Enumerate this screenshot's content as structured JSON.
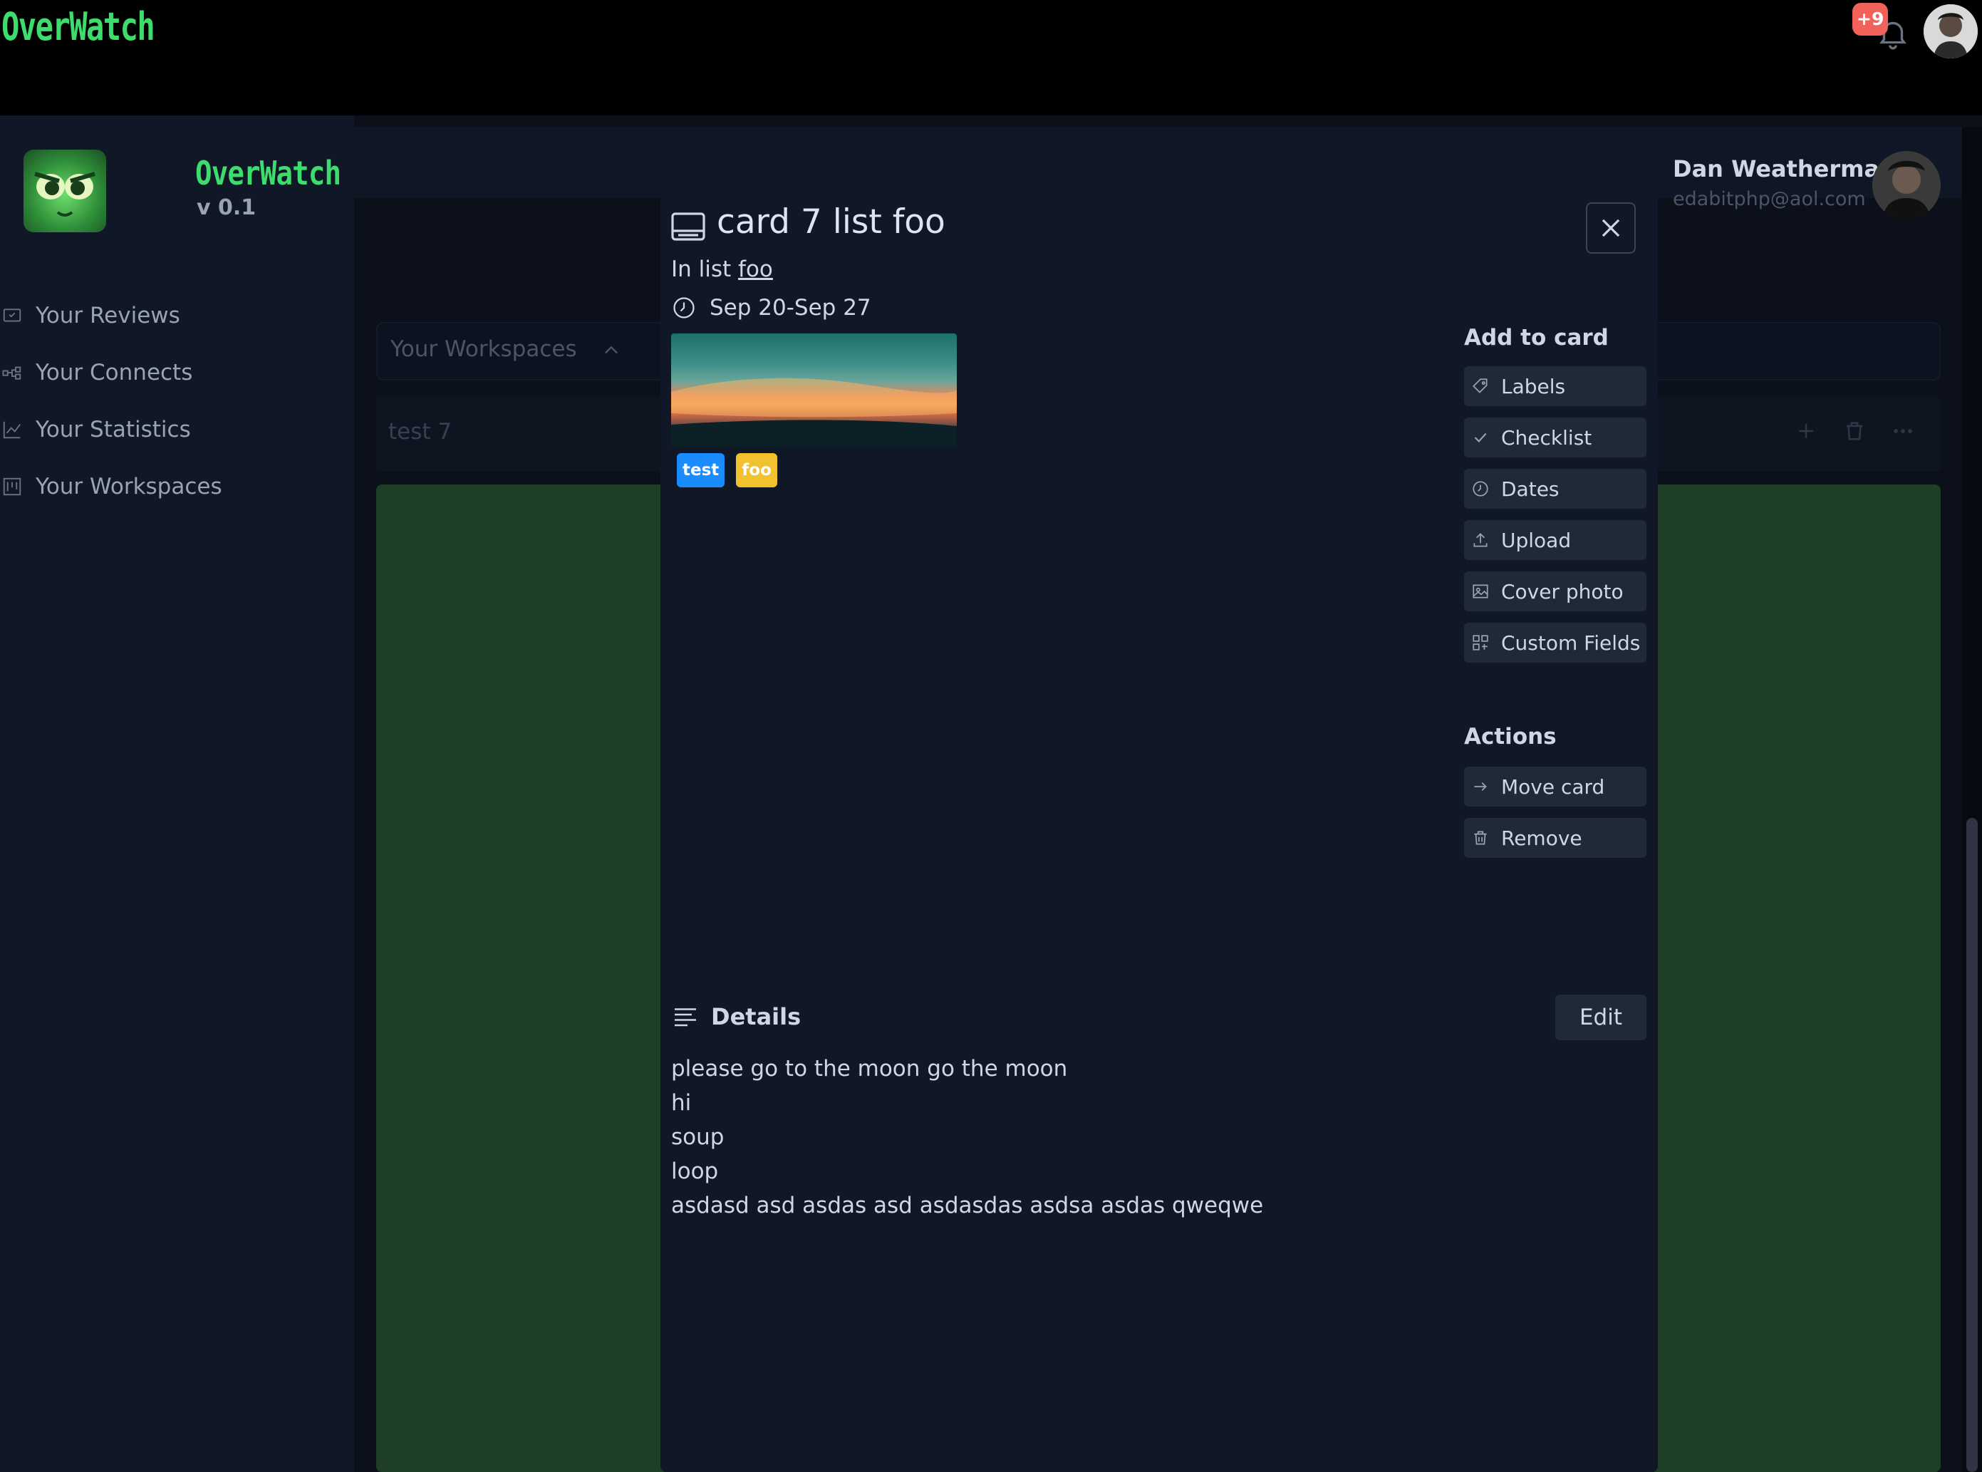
{
  "topbar": {
    "brand": "OverWatch",
    "notification_count": "+9"
  },
  "sidebar": {
    "title": "OverWatch",
    "version": "v 0.1",
    "items": [
      {
        "label": "Your Reviews",
        "icon": "review-icon"
      },
      {
        "label": "Your Connects",
        "icon": "connect-icon"
      },
      {
        "label": "Your Statistics",
        "icon": "chart-icon"
      },
      {
        "label": "Your Workspaces",
        "icon": "workspace-icon"
      }
    ]
  },
  "user": {
    "name": "Dan Weatherman",
    "email": "edabitphp@aol.com"
  },
  "board": {
    "workspaces_label": "Your Workspaces",
    "list_title": "test 7"
  },
  "modal": {
    "title": "card 7 list foo",
    "in_list_prefix": "In list",
    "list_name": "foo",
    "dates": "Sep 20-Sep 27",
    "labels": [
      {
        "text": "test",
        "color": "#1a8cff"
      },
      {
        "text": "foo",
        "color": "#f2c12e"
      }
    ],
    "add_to_card_heading": "Add to card",
    "add_to_card": [
      {
        "label": "Labels",
        "icon": "tag-icon"
      },
      {
        "label": "Checklist",
        "icon": "check-icon"
      },
      {
        "label": "Dates",
        "icon": "clock-icon"
      },
      {
        "label": "Upload",
        "icon": "upload-icon"
      },
      {
        "label": "Cover photo",
        "icon": "image-icon"
      },
      {
        "label": "Custom Fields",
        "icon": "fields-icon"
      }
    ],
    "actions_heading": "Actions",
    "actions": [
      {
        "label": "Move card",
        "icon": "arrow-right-icon"
      },
      {
        "label": "Remove",
        "icon": "trash-icon"
      }
    ],
    "details_heading": "Details",
    "edit_label": "Edit",
    "details_lines": [
      "please go to the moon go the moon",
      "hi",
      "soup",
      "loop",
      "asdasd asd asdas asd asdasdas asdsa asdas qweqwe"
    ]
  }
}
